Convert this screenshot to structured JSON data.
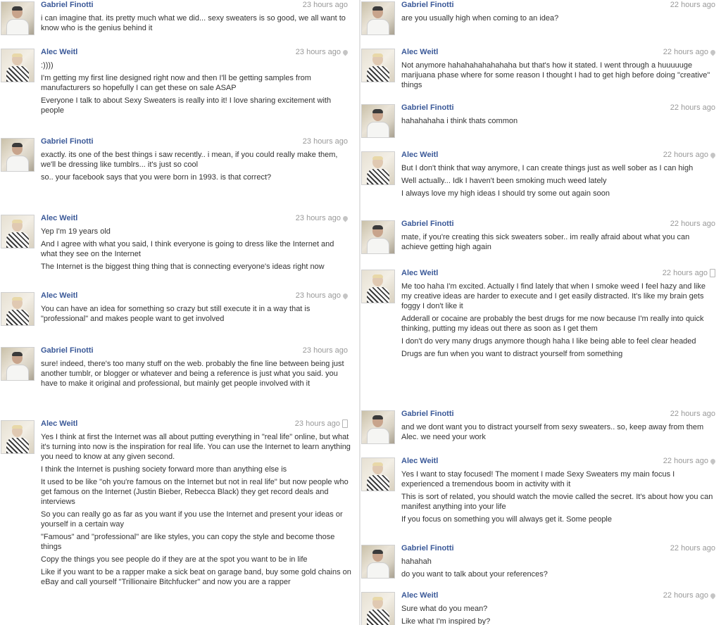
{
  "left": [
    {
      "author": "Gabriel Finotti",
      "time": "23 hours ago",
      "meta": "",
      "avatar": "gabriel",
      "lines": [
        "i can imagine that. its pretty much what we did... sexy sweaters is so good, we all want to know who is the genius behind it"
      ]
    },
    {
      "author": "Alec Weitl",
      "time": "23 hours ago",
      "meta": "pin",
      "avatar": "alec",
      "lines": [
        ":))))",
        "I'm getting my first line designed right now and then I'll be getting samples from manufacturers so hopefully I can get these on sale ASAP",
        "Everyone I talk to about Sexy Sweaters is really into it! I love sharing excitement with people"
      ]
    },
    {
      "author": "Gabriel Finotti",
      "time": "23 hours ago",
      "meta": "",
      "avatar": "gabriel",
      "lines": [
        "exactly. its one of the best things i saw recently.. i mean, if you could really make them, we'll be dressing like tumblrs... it's just so cool",
        "so.. your facebook says that you were born in 1993. is that correct?"
      ]
    },
    {
      "author": "Alec Weitl",
      "time": "23 hours ago",
      "meta": "pin",
      "avatar": "alec",
      "lines": [
        "Yep I'm 19 years old",
        "And I agree with what you said, I think everyone is going to dress like the Internet and what they see on the Internet",
        "The Internet is the biggest thing thing that is connecting everyone's ideas right now"
      ]
    },
    {
      "author": "Alec Weitl",
      "time": "23 hours ago",
      "meta": "pin",
      "avatar": "alec",
      "lines": [
        "You can have an idea for something so crazy but still execute it in a way that is \"professional\" and makes people want to get involved"
      ]
    },
    {
      "author": "Gabriel Finotti",
      "time": "23 hours ago",
      "meta": "",
      "avatar": "gabriel",
      "lines": [
        "sure! indeed, there's too many stuff on the web. probably the fine line between being just another tumblr, or blogger or whatever and being a reference is just what you said. you have to make it original and professional, but mainly get people involved with it"
      ]
    },
    {
      "author": "Alec Weitl",
      "time": "23 hours ago",
      "meta": "phone",
      "avatar": "alec",
      "lines": [
        "Yes I think at first the Internet was all about putting everything in \"real life\" online, but what it's turning into now is the inspiration for real life. You can use the Internet to learn anything you need to know at any given second.",
        "I think the Internet is pushing society forward more than anything else is",
        "It used to be like \"oh you're famous on the Internet but not in real life\" but now people who get famous on the Internet (Justin Bieber, Rebecca Black) they get record deals and interviews",
        "So you can really go as far as you want if you use the Internet and present your ideas or yourself in a certain way",
        "\"Famous\" and \"professional\" are like styles, you can copy the style and become those things",
        "Copy the things you see people do if they are at the spot you want to be in life",
        "Like if you want to be a rapper make a sick beat on garage band, buy some gold chains on eBay and call yourself \"Trillionaire Bitchfucker\" and now you are a rapper"
      ]
    }
  ],
  "right": [
    {
      "author": "Gabriel Finotti",
      "time": "22 hours ago",
      "meta": "",
      "avatar": "gabriel",
      "lines": [
        "are you usually high when coming to an idea?"
      ]
    },
    {
      "author": "Alec Weitl",
      "time": "22 hours ago",
      "meta": "pin",
      "avatar": "alec",
      "lines": [
        "Not anymore hahahahahahahaha but that's how it stated. I went through a huuuuuge marijuana phase where for some reason I thought I had to get high before doing \"creative\" things"
      ]
    },
    {
      "author": "Gabriel Finotti",
      "time": "22 hours ago",
      "meta": "",
      "avatar": "gabriel",
      "lines": [
        "hahahahaha i think thats common"
      ]
    },
    {
      "author": "Alec Weitl",
      "time": "22 hours ago",
      "meta": "pin",
      "avatar": "alec",
      "lines": [
        "But I don't think that way anymore, I can create things just as well sober as I can high",
        "Well actually... Idk I haven't been smoking much weed lately",
        "I always love my high ideas I should try some out again soon"
      ]
    },
    {
      "author": "Gabriel Finotti",
      "time": "22 hours ago",
      "meta": "",
      "avatar": "gabriel",
      "lines": [
        "mate, if you're creating this sick sweaters sober.. im really afraid about what you can achieve getting high again"
      ]
    },
    {
      "author": "Alec Weitl",
      "time": "22 hours ago",
      "meta": "phone",
      "avatar": "alec",
      "lines": [
        "Me too haha I'm excited. Actually I find lately that when I smoke weed I feel hazy and like my creative ideas are harder to execute and I get easily distracted. It's like my brain gets foggy I don't like it",
        "Adderall or cocaine are probably the best drugs for me now because I'm really into quick thinking, putting my ideas out there as soon as I get them",
        "I don't do very many drugs anymore though haha I like being able to feel clear headed",
        "Drugs are fun when you want to distract yourself from something"
      ]
    },
    {
      "author": "Gabriel Finotti",
      "time": "22 hours ago",
      "meta": "",
      "avatar": "gabriel",
      "lines": [
        "and we dont want you to distract yourself from sexy sweaters.. so, keep away from them Alec. we need your work"
      ]
    },
    {
      "author": "Alec Weitl",
      "time": "22 hours ago",
      "meta": "pin",
      "avatar": "alec",
      "lines": [
        "Yes I want to stay focused! The moment I made Sexy Sweaters my main focus I experienced a tremendous boom in activity with it",
        "This is sort of related, you should watch the movie called the secret. It's about how you can manifest anything into your life",
        "If you focus on something you will always get it. Some people"
      ]
    },
    {
      "author": "Gabriel Finotti",
      "time": "22 hours ago",
      "meta": "",
      "avatar": "gabriel",
      "lines": [
        "hahahah",
        "do you want to talk about your references?"
      ]
    },
    {
      "author": "Alec Weitl",
      "time": "22 hours ago",
      "meta": "pin",
      "avatar": "alec",
      "lines": [
        "Sure what do you mean?",
        "Like what I'm inspired by?"
      ]
    }
  ]
}
